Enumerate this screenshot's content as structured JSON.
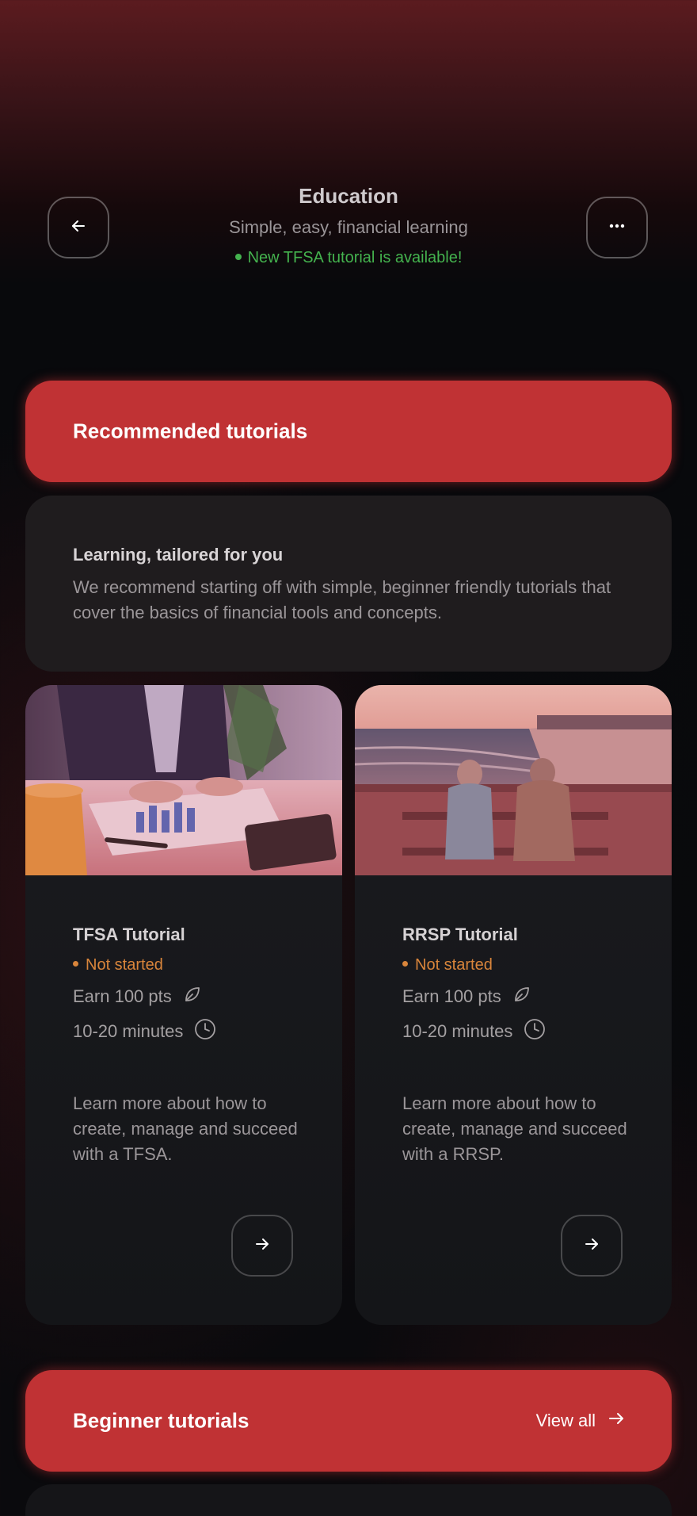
{
  "header": {
    "title": "Education",
    "subtitle": "Simple, easy, financial learning",
    "status": "New TFSA tutorial is available!",
    "back_icon": "arrow-left-icon",
    "more_icon": "more-horizontal-icon"
  },
  "recommended": {
    "title": "Recommended tutorials",
    "intro": {
      "title": "Learning, tailored for you",
      "text": "We recommend starting off with simple, beginner friendly tutorials that cover the basics of financial tools and concepts."
    },
    "tutorials": [
      {
        "title": "TFSA Tutorial",
        "status": "Not started",
        "points": "Earn 100 pts",
        "duration": "10-20 minutes",
        "description": "Learn more about how to create, manage and succeed with a TFSA.",
        "image": "person-reviewing-financial-charts-photo"
      },
      {
        "title": "RRSP Tutorial",
        "status": "Not started",
        "points": "Earn 100 pts",
        "duration": "10-20 minutes",
        "description": "Learn more about how to create, manage and succeed with a RRSP.",
        "image": "couple-on-beach-bench-photo"
      }
    ]
  },
  "beginner": {
    "title": "Beginner tutorials",
    "view_all": "View all"
  },
  "colors": {
    "accent_red": "#c03234",
    "status_green": "#44b24e",
    "status_orange": "#d9853b",
    "background": "#0a0a0d"
  }
}
